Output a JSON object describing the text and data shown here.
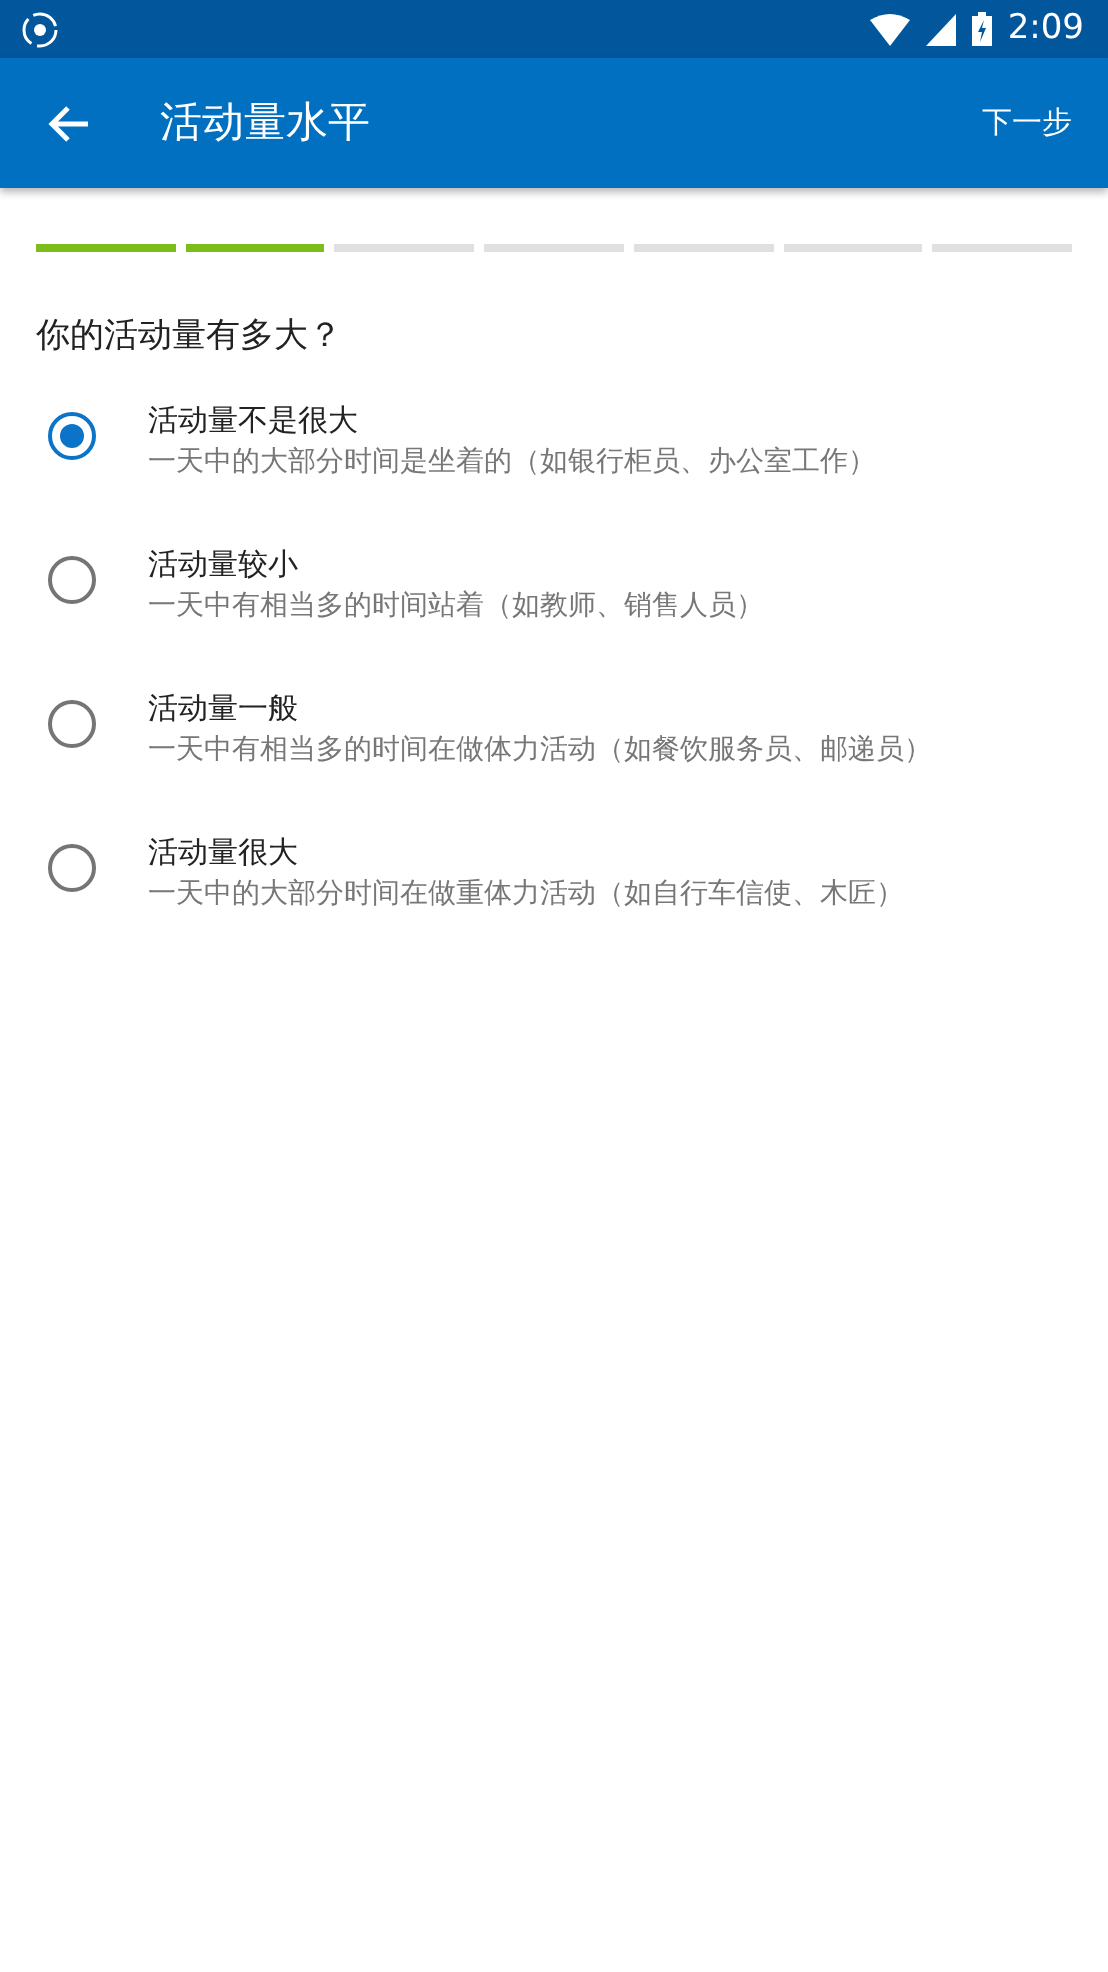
{
  "status_bar": {
    "time": "2:09"
  },
  "app_bar": {
    "title": "活动量水平",
    "action": "下一步"
  },
  "progress": [
    {
      "done": true
    },
    {
      "done": true
    },
    {
      "done": false
    },
    {
      "done": false
    },
    {
      "done": false
    },
    {
      "done": false
    },
    {
      "done": false
    }
  ],
  "question": "你的活动量有多大？",
  "options": [
    {
      "label": "活动量不是很大",
      "description": "一天中的大部分时间是坐着的（如银行柜员、办公室工作）",
      "selected": true
    },
    {
      "label": "活动量较小",
      "description": "一天中有相当多的时间站着（如教师、销售人员）",
      "selected": false
    },
    {
      "label": "活动量一般",
      "description": "一天中有相当多的时间在做体力活动（如餐饮服务员、邮递员）",
      "selected": false
    },
    {
      "label": "活动量很大",
      "description": "一天中的大部分时间在做重体力活动（如自行车信使、木匠）",
      "selected": false
    }
  ]
}
